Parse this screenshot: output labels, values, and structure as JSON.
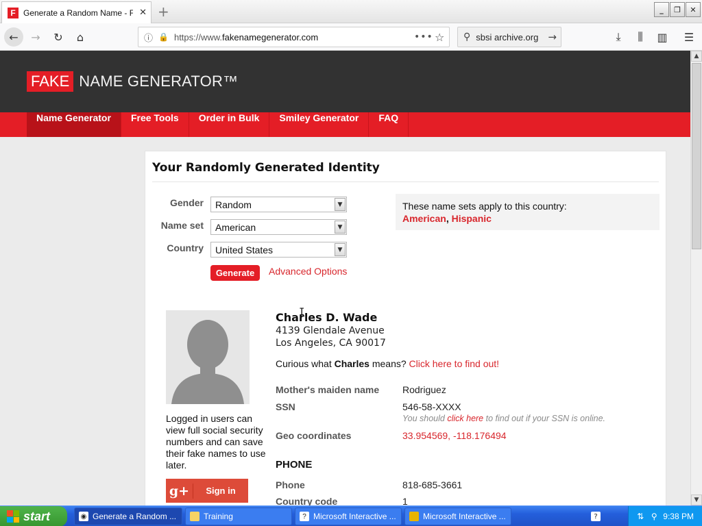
{
  "browser": {
    "tab_title": "Generate a Random Name - Fake N",
    "tab_favicon_letter": "F",
    "url_prefix": "https://www.",
    "url_domain": "fakenamegenerator.com",
    "search_text": "sbsi archive.org",
    "window_min": "_",
    "window_restore": "❐",
    "window_close": "✕"
  },
  "site": {
    "logo_fake": "FAKE",
    "logo_rest": "NAME GENERATOR™",
    "nav": [
      "Name Generator",
      "Free Tools",
      "Order in Bulk",
      "Smiley Generator",
      "FAQ"
    ],
    "active_nav": "Name Generator"
  },
  "form": {
    "heading": "Your Randomly Generated Identity",
    "gender_label": "Gender",
    "gender_value": "Random",
    "nameset_label": "Name set",
    "nameset_value": "American",
    "country_label": "Country",
    "country_value": "United States",
    "generate_label": "Generate",
    "advanced_label": "Advanced Options"
  },
  "nameset_info": {
    "text": "These name sets apply to this country:",
    "link1": "American",
    "separator": ",",
    "link2": "Hispanic"
  },
  "sidebar": {
    "login_note": "Logged in users can view full social security numbers and can save their fake names to use later.",
    "gplus_icon": "g+",
    "signin_label": "Sign in"
  },
  "identity": {
    "name": "Charles D. Wade",
    "address1": "4139 Glendale Avenue",
    "address2": "Los Angeles, CA 90017",
    "curious_prefix": "Curious what ",
    "curious_name": "Charles",
    "curious_mid": " means? ",
    "curious_link": "Click here to find out!",
    "maiden_label": "Mother's maiden name",
    "maiden_value": "Rodriguez",
    "ssn_label": "SSN",
    "ssn_value": "546-58-XXXX",
    "ssn_hint_prefix": "You should ",
    "ssn_hint_link": "click here",
    "ssn_hint_suffix": " to find out if your SSN is online.",
    "geo_label": "Geo coordinates",
    "geo_value": "33.954569, -118.176494",
    "phone_section": "PHONE",
    "phone_label": "Phone",
    "phone_value": "818-685-3661",
    "cc_label": "Country code",
    "cc_value": "1"
  },
  "taskbar": {
    "start_label": "start",
    "tasks": [
      "Generate a Random ...",
      "Training",
      "Microsoft Interactive ...",
      "Microsoft Interactive ..."
    ],
    "clock": "9:38 PM"
  },
  "colors": {
    "brand_red": "#e41e26",
    "header_dark": "#323232",
    "link_red": "#d8262c"
  }
}
